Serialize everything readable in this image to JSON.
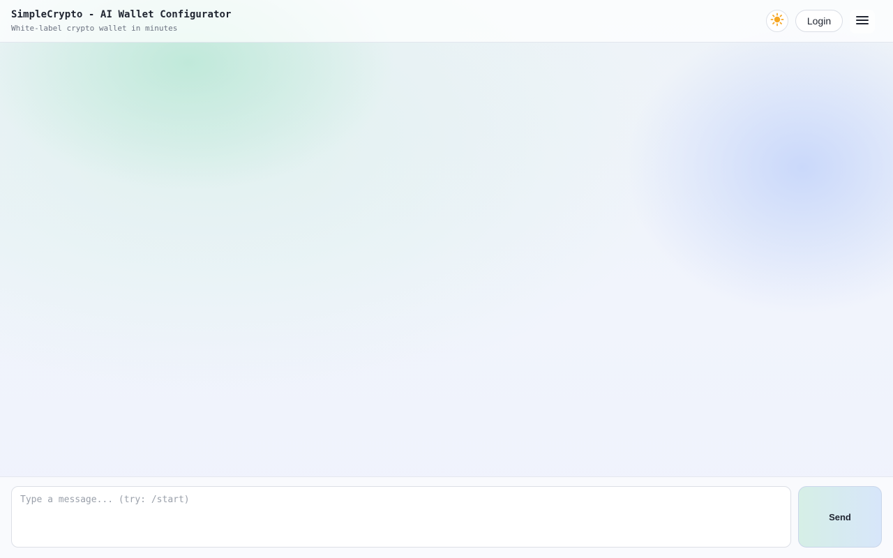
{
  "header": {
    "title": "SimpleCrypto - AI Wallet Configurator",
    "subtitle": "White-label crypto wallet in minutes",
    "theme_toggle_icon": "sun-icon",
    "login_label": "Login",
    "menu_icon": "hamburger-menu-icon"
  },
  "composer": {
    "placeholder": "Type a message... (try: /start)",
    "value": "",
    "send_label": "Send"
  },
  "colors": {
    "send_gradient_start": "#d6efe6",
    "send_gradient_end": "#d7e6fa",
    "sun_color": "#f5a623",
    "text_primary": "#1f2430",
    "text_muted": "#6b7280"
  }
}
